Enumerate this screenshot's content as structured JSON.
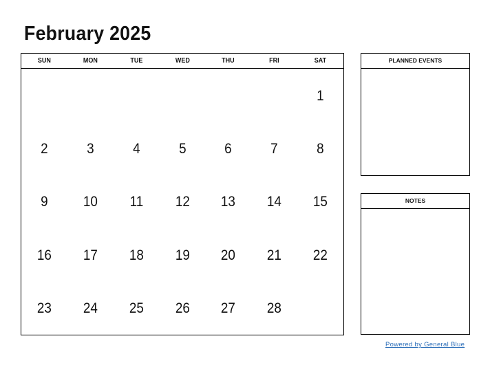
{
  "title": "February 2025",
  "weekdays": [
    "SUN",
    "MON",
    "TUE",
    "WED",
    "THU",
    "FRI",
    "SAT"
  ],
  "weeks": [
    [
      "",
      "",
      "",
      "",
      "",
      "",
      "1"
    ],
    [
      "2",
      "3",
      "4",
      "5",
      "6",
      "7",
      "8"
    ],
    [
      "9",
      "10",
      "11",
      "12",
      "13",
      "14",
      "15"
    ],
    [
      "16",
      "17",
      "18",
      "19",
      "20",
      "21",
      "22"
    ],
    [
      "23",
      "24",
      "25",
      "26",
      "27",
      "28",
      ""
    ]
  ],
  "planned_events": {
    "label": "PLANNED EVENTS"
  },
  "notes": {
    "label": "NOTES"
  },
  "footer": {
    "powered_by": "Powered by General Blue",
    "link_color": "#2a6db8"
  }
}
